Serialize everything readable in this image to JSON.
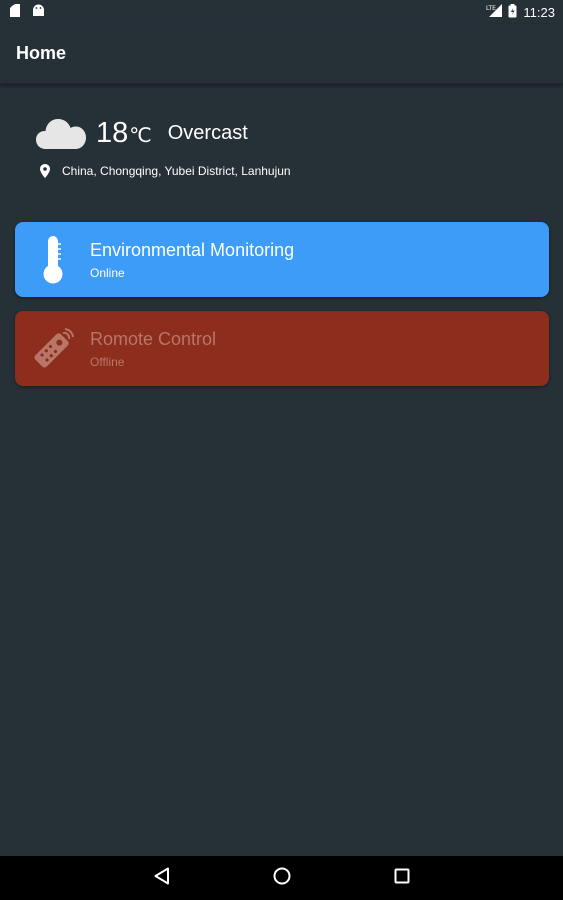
{
  "status_bar": {
    "time": "11:23",
    "icons": [
      "notification-icon",
      "android-icon",
      "signal-icon",
      "battery-icon"
    ]
  },
  "app_bar": {
    "title": "Home"
  },
  "weather": {
    "temperature": "18",
    "unit": "℃",
    "condition": "Overcast",
    "location": "China, Chongqing, Yubei District, Lanhujun",
    "icon": "cloud-icon"
  },
  "devices": [
    {
      "title": "Environmental Monitoring",
      "status": "Online",
      "icon": "thermometer-icon",
      "color": "#3d9cf7"
    },
    {
      "title": "Romote Control",
      "status": "Offline",
      "icon": "remote-control-icon",
      "color": "#8d2d1e"
    }
  ],
  "nav_bar": {
    "buttons": [
      "back-icon",
      "home-icon",
      "recents-icon"
    ]
  },
  "colors": {
    "background": "#263037",
    "online_card": "#3d9cf7",
    "offline_card": "#8d2d1e",
    "offline_text": "#b77668"
  }
}
